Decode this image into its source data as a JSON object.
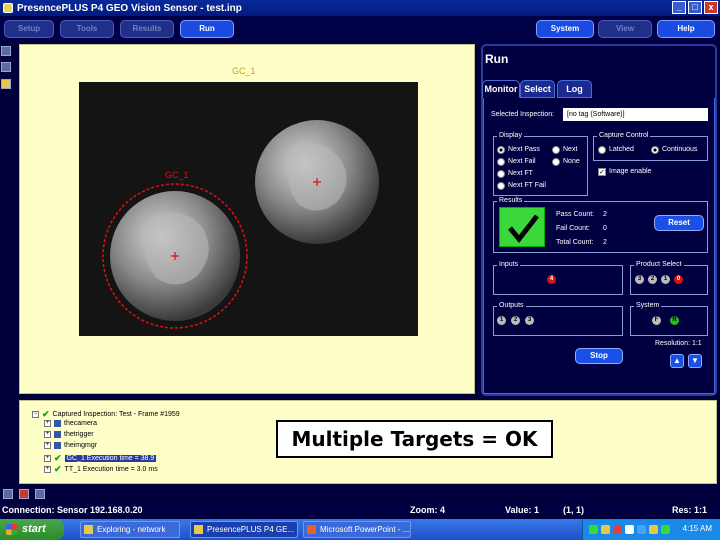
{
  "window": {
    "title": "PresencePLUS P4 GEO Vision Sensor - test.inp",
    "controls": [
      "_",
      "□",
      "x"
    ]
  },
  "menu": {
    "items": [
      "Setup",
      "Tools",
      "Results",
      "Run"
    ],
    "active": "Run",
    "right_items": [
      "System",
      "Help"
    ],
    "help_neighbor": "View"
  },
  "viewer": {
    "gc_label_top": "GC_1",
    "gc_label_left": "GC_1"
  },
  "run_panel": {
    "title": "Run",
    "tabs": [
      "Monitor",
      "Select",
      "Log"
    ],
    "selected_inspection_label": "Selected Inspection:",
    "selected_inspection_value": "[no tag (Software)]",
    "display": {
      "title": "Display",
      "options": [
        "Next Pass",
        "Next Fail",
        "Next FT",
        "Next FT Fail"
      ],
      "options_right": [
        "Next",
        "None"
      ]
    },
    "capture": {
      "title": "Capture Control",
      "options": [
        "Latched",
        "Continuous"
      ],
      "selected": "Continuous",
      "image_enable_label": "Image enable",
      "image_enable_checked": true
    },
    "results": {
      "title": "Results",
      "pass_label": "Pass Count:",
      "pass_value": "2",
      "fail_label": "Fail Count:",
      "fail_value": "0",
      "total_label": "Total Count:",
      "total_value": "2",
      "reset_label": "Reset"
    },
    "inputs": {
      "title": "Inputs",
      "indicator": "4"
    },
    "product_select": {
      "title": "Product Select",
      "indicators": [
        "3",
        "2",
        "1",
        "0"
      ]
    },
    "outputs": {
      "title": "Outputs",
      "indicators": [
        "1",
        "2",
        "3"
      ]
    },
    "system": {
      "title": "System",
      "indicators": [
        "F",
        "R"
      ]
    },
    "stop_label": "Stop",
    "resolution_label": "Resolution: 1:1"
  },
  "tree": {
    "root": "Captured Inspection: Test - Frame #1959",
    "children": [
      "thecamera",
      "thetrigger",
      "theimgmgr",
      "GC_1 Execution time = 38.9",
      "TT_1 Execution time = 3.0 ms"
    ]
  },
  "caption": "Multiple Targets = OK",
  "status_bar": {
    "connection": "Connection: Sensor 192.168.0.20",
    "zoom": "Zoom: 4",
    "value": "Value: 1",
    "coords": "(1, 1)",
    "res": "Res: 1:1"
  },
  "taskbar": {
    "start": "start",
    "tasks": [
      "Exploring - network",
      "PresencePLUS P4 GE...",
      "Microsoft PowerPoint - ..."
    ],
    "clock": "4:15 AM"
  },
  "colors": {
    "background": "#00003a",
    "panel": "#fefec8",
    "accent": "#1a50e8",
    "pass_green": "#3ad83a",
    "circle_red": "#e01010"
  }
}
